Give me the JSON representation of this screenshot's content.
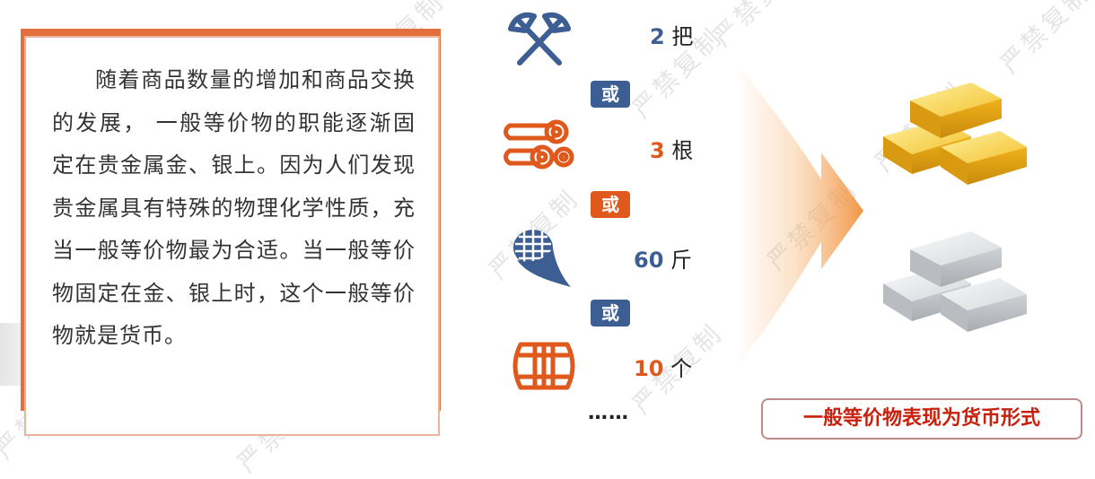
{
  "paragraph": "随着商品数量的增加和商品交换的发展， 一般等价物的职能逐渐固定在贵金属金、银上。因为人们发现贵金属具有特殊的物理化学性质，充当一般等价物最为合适。当一般等价物固定在金、银上时，这个一般等价物就是货币。",
  "exchange": {
    "items": [
      {
        "icon": "axe-icon",
        "num": "2",
        "unit": "把",
        "color": "#3d5e93"
      },
      {
        "icon": "wood-logs-icon",
        "num": "3",
        "unit": "根",
        "color": "#e0591c"
      },
      {
        "icon": "corn-icon",
        "num": "60",
        "unit": "斤",
        "color": "#3d5e93"
      },
      {
        "icon": "barrel-icon",
        "num": "10",
        "unit": "个",
        "color": "#e0591c"
      }
    ],
    "connectors": [
      {
        "label": "或",
        "color": "#3d5e93"
      },
      {
        "label": "或",
        "color": "#e0591c"
      },
      {
        "label": "或",
        "color": "#3d5e93"
      }
    ],
    "ellipsis": "……"
  },
  "caption": "一般等价物表现为货币形式",
  "watermark": "严禁复制",
  "colors": {
    "blue": "#3d5e93",
    "orange": "#e0591c",
    "accent": "#e36f3d",
    "caption_text": "#c8200d",
    "gold": "#f2c12e",
    "silver": "#d6d8da"
  }
}
